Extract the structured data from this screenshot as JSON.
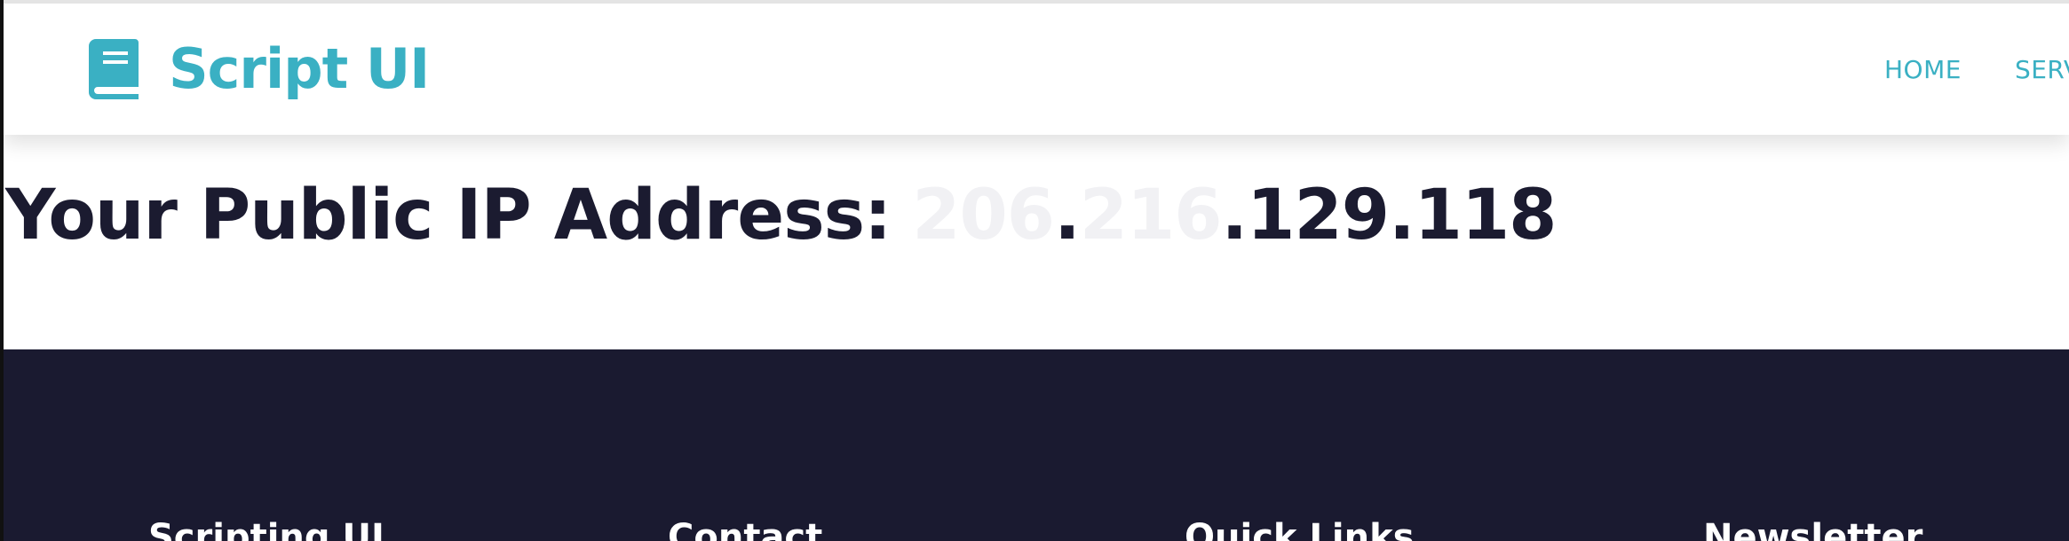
{
  "brand": {
    "name": "Script UI",
    "icon": "book-icon",
    "color": "#3ab0c3"
  },
  "nav": {
    "items": [
      {
        "label": "HOME"
      },
      {
        "label": "SERVICES"
      }
    ]
  },
  "hero": {
    "label": "Your Public IP Address:",
    "ip_parts": [
      "206",
      ".",
      "216",
      ".129.118"
    ]
  },
  "footer": {
    "headings": [
      "Scripting UI",
      "Contact",
      "Quick Links",
      "Newsletter"
    ],
    "background": "#1a1a30"
  }
}
